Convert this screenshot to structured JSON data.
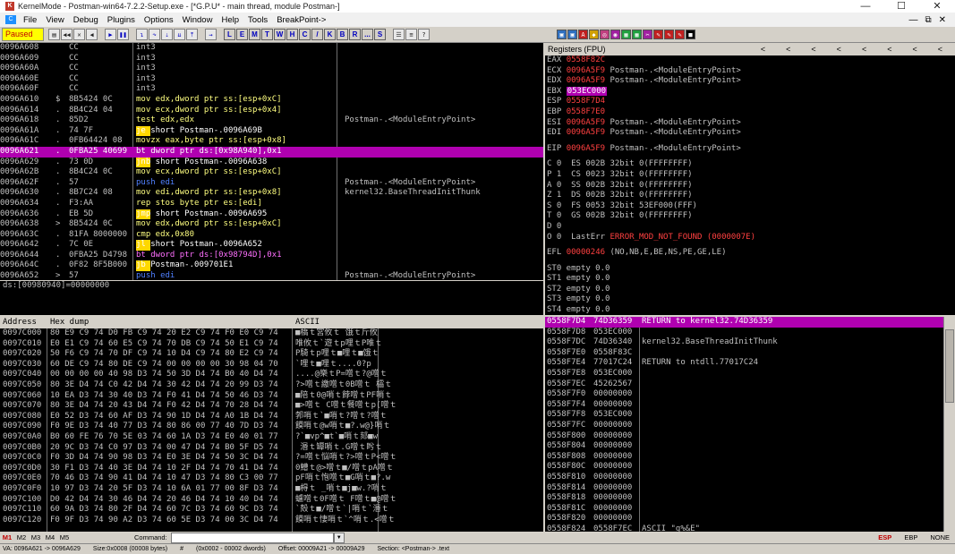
{
  "window": {
    "title": "KernelMode - Postman-win64-7.2.2-Setup.exe - [*G.P.U* - main thread, module Postman-]",
    "controls": [
      "—",
      "☐",
      "✕"
    ]
  },
  "menu": {
    "items": [
      "File",
      "View",
      "Debug",
      "Plugins",
      "Options",
      "Window",
      "Help",
      "Tools",
      "BreakPoint->"
    ],
    "mdi_controls": [
      "—",
      "⧉",
      "✕"
    ]
  },
  "toolbar": {
    "status": "Paused",
    "letters": [
      "L",
      "E",
      "M",
      "T",
      "W",
      "H",
      "C",
      "/",
      "K",
      "B",
      "R",
      "...",
      "S"
    ]
  },
  "disasm": {
    "rows": [
      {
        "addr": "0096A608",
        "mark": "",
        "hex": "CC",
        "asm": "int3",
        "cmt": ""
      },
      {
        "addr": "0096A609",
        "mark": "",
        "hex": "CC",
        "asm": "int3",
        "cmt": ""
      },
      {
        "addr": "0096A60A",
        "mark": "",
        "hex": "CC",
        "asm": "int3",
        "cmt": ""
      },
      {
        "addr": "0096A60E",
        "mark": "",
        "hex": "CC",
        "asm": "int3",
        "cmt": ""
      },
      {
        "addr": "0096A60F",
        "mark": "",
        "hex": "CC",
        "asm": "int3",
        "cmt": ""
      },
      {
        "addr": "0096A610",
        "mark": "$",
        "hex": "8B5424 0C",
        "asm": "mov edx,dword ptr ss:[esp+0xC]",
        "cmt": ""
      },
      {
        "addr": "0096A614",
        "mark": ".",
        "hex": "8B4C24 04",
        "asm": "mov ecx,dword ptr ss:[esp+0x4]",
        "cmt": ""
      },
      {
        "addr": "0096A618",
        "mark": ".",
        "hex": "85D2",
        "asm": "test edx,edx",
        "cmt": "Postman-.<ModuleEntryPoint>"
      },
      {
        "addr": "0096A61A",
        "mark": ".",
        "hex": "74 7F",
        "asm": "je short Postman-.0096A69B",
        "cmt": ""
      },
      {
        "addr": "0096A61C",
        "mark": ".",
        "hex": "0FB64424 08",
        "asm": "movzx eax,byte ptr ss:[esp+0x8]",
        "cmt": ""
      },
      {
        "addr": "0096A621",
        "mark": ".",
        "hex": "0FBA25 40699",
        "asm": "bt dword ptr ds:[0x98A940],0x1",
        "cmt": ""
      },
      {
        "addr": "0096A629",
        "mark": ".",
        "hex": "73 0D",
        "asm": "jnb short Postman-.0096A638",
        "cmt": ""
      },
      {
        "addr": "0096A62B",
        "mark": ".",
        "hex": "8B4C24 0C",
        "asm": "mov ecx,dword ptr ss:[esp+0xC]",
        "cmt": ""
      },
      {
        "addr": "0096A62F",
        "mark": ".",
        "hex": "57",
        "asm": "push edi",
        "cmt": "Postman-.<ModuleEntryPoint>"
      },
      {
        "addr": "0096A630",
        "mark": ".",
        "hex": "8B7C24 08",
        "asm": "mov edi,dword ptr ss:[esp+0x8]",
        "cmt": "kernel32.BaseThreadInitThunk"
      },
      {
        "addr": "0096A634",
        "mark": ".",
        "hex": "F3:AA",
        "asm": "rep stos byte ptr es:[edi]",
        "cmt": ""
      },
      {
        "addr": "0096A636",
        "mark": ".",
        "hex": "EB 5D",
        "asm": "jmp short Postman-.0096A695",
        "cmt": ""
      },
      {
        "addr": "0096A638",
        "mark": ">",
        "hex": "8B5424 0C",
        "asm": "mov edx,dword ptr ss:[esp+0xC]",
        "cmt": ""
      },
      {
        "addr": "0096A63C",
        "mark": ".",
        "hex": "81FA 8000000",
        "asm": "cmp edx,0x80",
        "cmt": ""
      },
      {
        "addr": "0096A642",
        "mark": ".",
        "hex": "7C 0E",
        "asm": "jl short Postman-.0096A652",
        "cmt": ""
      },
      {
        "addr": "0096A644",
        "mark": ".",
        "hex": "0FBA25 D4798",
        "asm": "bt dword ptr ds:[0x98794D],0x1",
        "cmt": ""
      },
      {
        "addr": "0096A64C",
        "mark": ".",
        "hex": "0F82 8F5B000",
        "asm": "jb Postman-.009701E1",
        "cmt": ""
      },
      {
        "addr": "0096A652",
        "mark": ">",
        "hex": "57",
        "asm": "push edi",
        "cmt": "Postman-.<ModuleEntryPoint>"
      }
    ]
  },
  "info": {
    "line": "ds:[00980940]=00000000"
  },
  "registers": {
    "header": "Registers (FPU)",
    "nav_arrows": [
      "<",
      "<",
      "<",
      "<",
      "<",
      "<",
      "<",
      "<"
    ],
    "gp": [
      {
        "name": "EAX",
        "value": "0558F82C",
        "note": ""
      },
      {
        "name": "ECX",
        "value": "0096A5F9",
        "note": "Postman-.<ModuleEntryPoint>"
      },
      {
        "name": "EDX",
        "value": "0096A5F9",
        "note": "Postman-.<ModuleEntryPoint>"
      },
      {
        "name": "EBX",
        "value": "053EC000",
        "note": ""
      },
      {
        "name": "ESP",
        "value": "0558F7D4",
        "note": ""
      },
      {
        "name": "EBP",
        "value": "0558F7E0",
        "note": ""
      },
      {
        "name": "ESI",
        "value": "0096A5F9",
        "note": "Postman-.<ModuleEntryPoint>"
      },
      {
        "name": "EDI",
        "value": "0096A5F9",
        "note": "Postman-.<ModuleEntryPoint>"
      }
    ],
    "eip": {
      "name": "EIP",
      "value": "0096A5F9",
      "note": "Postman-.<ModuleEntryPoint>"
    },
    "flags": [
      "C 0  ES 002B 32bit 0(FFFFFFFF)",
      "P 1  CS 0023 32bit 0(FFFFFFFF)",
      "A 0  SS 002B 32bit 0(FFFFFFFF)",
      "Z 1  DS 002B 32bit 0(FFFFFFFF)",
      "S 0  FS 0053 32bit 53EF000(FFF)",
      "T 0  GS 002B 32bit 0(FFFFFFFF)",
      "D 0",
      "O 0  LastErr"
    ],
    "lasterr": "ERROR_MOD_NOT_FOUND (0000007E)",
    "efl_label": "EFL",
    "efl_value": "00000246",
    "efl_note": "(NO,NB,E,BE,NS,PE,GE,LE)",
    "fpu": [
      "ST0 empty 0.0",
      "ST1 empty 0.0",
      "ST2 empty 0.0",
      "ST3 empty 0.0",
      "ST4 empty 0.0"
    ]
  },
  "dump": {
    "headers": {
      "address": "Address",
      "hex": "Hex dump",
      "ascii": "ASCII"
    },
    "rows": [
      {
        "addr": "0097C000",
        "hex": "80 E9 C9 74 D0 FB C9 74 20 E2 C9 74 F0 E0 C9 74",
        "ascii": "■橋ｔ宮攸ｔ 饿ｔ斤攸"
      },
      {
        "addr": "0097C010",
        "hex": "E0 E1 C9 74 60 E5 C9 74 70 DB C9 74 50 E1 C9 74",
        "ascii": "唯攸ｔ`遊ｔp哩ｔP唯ｔ"
      },
      {
        "addr": "0097C020",
        "hex": "50 F6 C9 74 70 DF C9 74 10 D4 C9 74 80 E2 C9 74",
        "ascii": "P騎ｔp哩ｔ■哩ｔ■饿ｔ"
      },
      {
        "addr": "0097C030",
        "hex": "60 DE C9 74 80 DE C9 74 00 00 00 00 30 98 04 70",
        "ascii": "`哩ｔ■哩ｔ....0?p"
      },
      {
        "addr": "0097C040",
        "hex": "00 00 00 00 40 98 D3 74 50 3D D4 74 B0 40 D4 74",
        "ascii": "....@樂ｔP=噌ｔ?@噌ｔ"
      },
      {
        "addr": "0097C050",
        "hex": "80 3E D4 74 C0 42 D4 74 30 42 D4 74 20 99 D3 74",
        "ascii": "?>噌ｔ繳噌ｔ0B噌ｔ 櫺ｔ"
      },
      {
        "addr": "0097C060",
        "hex": "10 EA D3 74 30 40 D3 74 F0 41 D4 74 50 46 D3 74",
        "ascii": "■陪ｔ0@哨ｔ餑噌ｔPF哨ｔ"
      },
      {
        "addr": "0097C070",
        "hex": "80 3E D4 74 20 43 D4 74 F0 42 D4 74 70 28 D4 74",
        "ascii": "■>噌ｔ C噌ｔ餐噌ｔp(噌ｔ"
      },
      {
        "addr": "0097C080",
        "hex": "E0 52 D3 74 60 AF D3 74 90 1D D4 74 A0 1B D4 74",
        "ascii": "郣哨ｔ`■哨ｔ?噌ｔ?噌ｔ"
      },
      {
        "addr": "0097C090",
        "hex": "F0 9E D3 74 40 77 D3 74 80 86 00 77 40 7D D3 74",
        "ascii": "饃哨ｔ@w哨ｔ■?.w@}哨ｔ"
      },
      {
        "addr": "0097C0A0",
        "hex": "B0 60 FE 76 70 5E 03 74 60 1A D3 74 E0 40 01 77",
        "ascii": "?`■vp^■t`■哨ｔ郂■w"
      },
      {
        "addr": "0097C0B0",
        "hex": "20 9C D3 74 C0 97 D3 74 00 47 D4 74 B0 5F D5 74",
        "ascii": " 湣ｔ罈哨ｔ.G噌ｔ盻ｔ"
      },
      {
        "addr": "0097C0C0",
        "hex": "F0 3D D4 74 90 98 D3 74 E0 3E D4 74 50 3C D4 74",
        "ascii": "?=噌ｔ悩哨ｔ?>噌ｔP<噌ｔ"
      },
      {
        "addr": "0097C0D0",
        "hex": "30 F1 D3 74 40 3E D4 74 10 2F D4 74 70 41 D4 74",
        "ascii": "0鰽ｔ@>噌ｔ■/噌ｔpA噌ｔ"
      },
      {
        "addr": "0097C0E0",
        "hex": "70 46 D3 74 90 41 D4 74 10 47 D3 74 80 C3 00 77",
        "ascii": "pF哨ｔ怉噌ｔ■G哨ｔ■?.w"
      },
      {
        "addr": "0097C0F0",
        "hex": "10 97 D3 74 20 5F D3 74 10 6A 01 77 00 8F D3 74",
        "ascii": "■棏ｔ _哨ｔ■j■w.?哨ｔ"
      },
      {
        "addr": "0097C100",
        "hex": "D0 42 D4 74 30 46 D4 74 20 46 D4 74 10 40 D4 74",
        "ascii": "蠦噌ｔ0F噌ｔ F噌ｔ■@噌ｔ"
      },
      {
        "addr": "0097C110",
        "hex": "60 9A D3 74 80 2F D4 74 60 7C D3 74 60 9C D3 74",
        "ascii": "`殻ｔ■/噌ｔ`|哨ｔ`湣ｔ"
      },
      {
        "addr": "0097C120",
        "hex": "F0 9F D3 74 90 A2 D3 74 60 5E D3 74 00 3C D4 74",
        "ascii": "饃哨ｔ悽哨ｔ`^哨ｔ.<噌ｔ"
      }
    ]
  },
  "stack": {
    "rows": [
      {
        "addr": "0558F7D4",
        "val": "74D36359",
        "cmt": "RETURN to kernel32.74D36359",
        "hl": true
      },
      {
        "addr": "0558F7D8",
        "val": "053EC000",
        "cmt": "",
        "hl": false
      },
      {
        "addr": "0558F7DC",
        "val": "74D36340",
        "cmt": "kernel32.BaseThreadInitThunk",
        "hl": false
      },
      {
        "addr": "0558F7E0",
        "val": "0558F83C",
        "cmt": "",
        "hl": false
      },
      {
        "addr": "0558F7E4",
        "val": "77017C24",
        "cmt": "RETURN to ntdll.77017C24",
        "hl": false
      },
      {
        "addr": "0558F7E8",
        "val": "053EC000",
        "cmt": "",
        "hl": false
      },
      {
        "addr": "0558F7EC",
        "val": "45262567",
        "cmt": "",
        "hl": false
      },
      {
        "addr": "0558F7F0",
        "val": "00000000",
        "cmt": "",
        "hl": false
      },
      {
        "addr": "0558F7F4",
        "val": "00000000",
        "cmt": "",
        "hl": false
      },
      {
        "addr": "0558F7F8",
        "val": "053EC000",
        "cmt": "",
        "hl": false
      },
      {
        "addr": "0558F7FC",
        "val": "00000000",
        "cmt": "",
        "hl": false
      },
      {
        "addr": "0558F800",
        "val": "00000000",
        "cmt": "",
        "hl": false
      },
      {
        "addr": "0558F804",
        "val": "00000000",
        "cmt": "",
        "hl": false
      },
      {
        "addr": "0558F808",
        "val": "00000000",
        "cmt": "",
        "hl": false
      },
      {
        "addr": "0558F80C",
        "val": "00000000",
        "cmt": "",
        "hl": false
      },
      {
        "addr": "0558F810",
        "val": "00000000",
        "cmt": "",
        "hl": false
      },
      {
        "addr": "0558F814",
        "val": "00000000",
        "cmt": "",
        "hl": false
      },
      {
        "addr": "0558F818",
        "val": "00000000",
        "cmt": "",
        "hl": false
      },
      {
        "addr": "0558F81C",
        "val": "00000000",
        "cmt": "",
        "hl": false
      },
      {
        "addr": "0558F820",
        "val": "00000000",
        "cmt": "",
        "hl": false
      },
      {
        "addr": "0558F824",
        "val": "0558F7EC",
        "cmt": "ASCII \"g%&E\"",
        "hl": false
      }
    ]
  },
  "cmdbar": {
    "mem_tabs": [
      "M1",
      "M2",
      "M3",
      "M4",
      "M5"
    ],
    "label": "Command:",
    "right_tabs": [
      "ESP",
      "EBP",
      "NONE"
    ]
  },
  "statusbar": {
    "va": "VA: 0096A621 -> 0096A629",
    "size": "Size:0x0008 (00008 bytes)",
    "hash": "#",
    "offset_dwords": "(0x0002 - 00002 dwords)",
    "offset": "Offset: 00009A21 -> 00009A29",
    "section": "Section: <Postman-> .text"
  },
  "colors": {
    "pane_bg": "#000000",
    "highlight": "#b000b0",
    "jump_marker": "#ffd700",
    "paused_bg": "#ffff00",
    "reg_changed": "#ff4040"
  }
}
